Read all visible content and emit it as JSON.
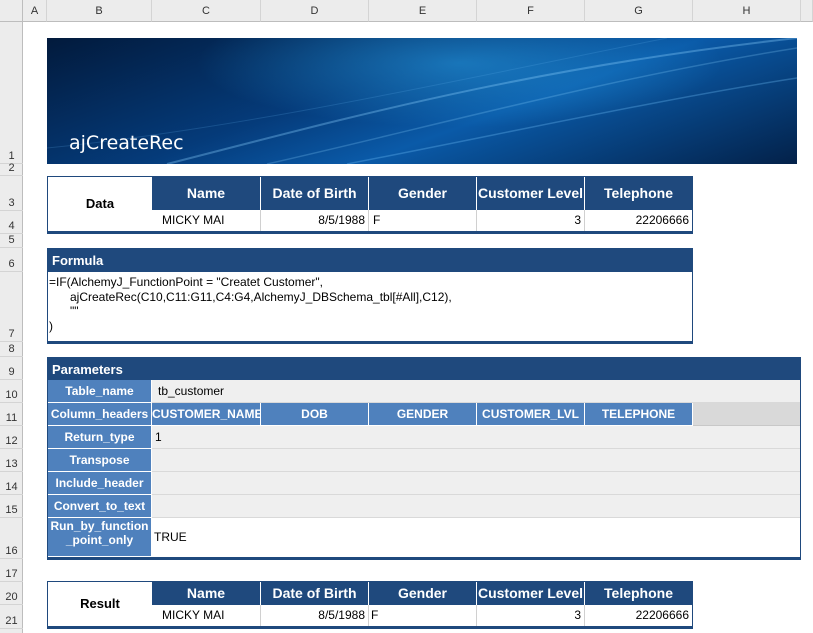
{
  "sheet": {
    "columns": [
      "A",
      "B",
      "C",
      "D",
      "E",
      "F",
      "G",
      "H"
    ],
    "rows": [
      "1",
      "2",
      "3",
      "4",
      "5",
      "6",
      "7",
      "8",
      "9",
      "10",
      "11",
      "12",
      "13",
      "14",
      "15",
      "16",
      "17",
      "20",
      "21"
    ]
  },
  "banner": {
    "title": "ajCreateRec"
  },
  "data_table": {
    "label": "Data",
    "headers": [
      "Name",
      "Date of Birth",
      "Gender",
      "Customer Level",
      "Telephone"
    ],
    "row": [
      "MICKY MAI",
      "8/5/1988",
      "F",
      "3",
      "22206666"
    ]
  },
  "formula": {
    "title": "Formula",
    "lines": [
      "=IF(AlchemyJ_FunctionPoint = \"Createt Customer\",",
      "ajCreateRec(C10,C11:G11,C4:G4,AlchemyJ_DBSchema_tbl[#All],C12),",
      "\"\"",
      ")"
    ]
  },
  "parameters": {
    "title": "Parameters",
    "rows": [
      {
        "name": "Table_name",
        "value": "tb_customer"
      },
      {
        "name": "Column_headers",
        "value": ""
      },
      {
        "name": "Return_type",
        "value": "1"
      },
      {
        "name": "Transpose",
        "value": ""
      },
      {
        "name": "Include_header",
        "value": ""
      },
      {
        "name": "Convert_to_text",
        "value": ""
      },
      {
        "name": "Run_by_function_point_only",
        "value": "TRUE"
      }
    ],
    "column_headers": [
      "CUSTOMER_NAME",
      "DOB",
      "GENDER",
      "CUSTOMER_LVL",
      "TELEPHONE"
    ]
  },
  "result_table": {
    "label": "Result",
    "headers": [
      "Name",
      "Date of Birth",
      "Gender",
      "Customer Level",
      "Telephone"
    ],
    "row": [
      "MICKY MAI",
      "8/5/1988",
      "F",
      "3",
      "22206666"
    ]
  }
}
